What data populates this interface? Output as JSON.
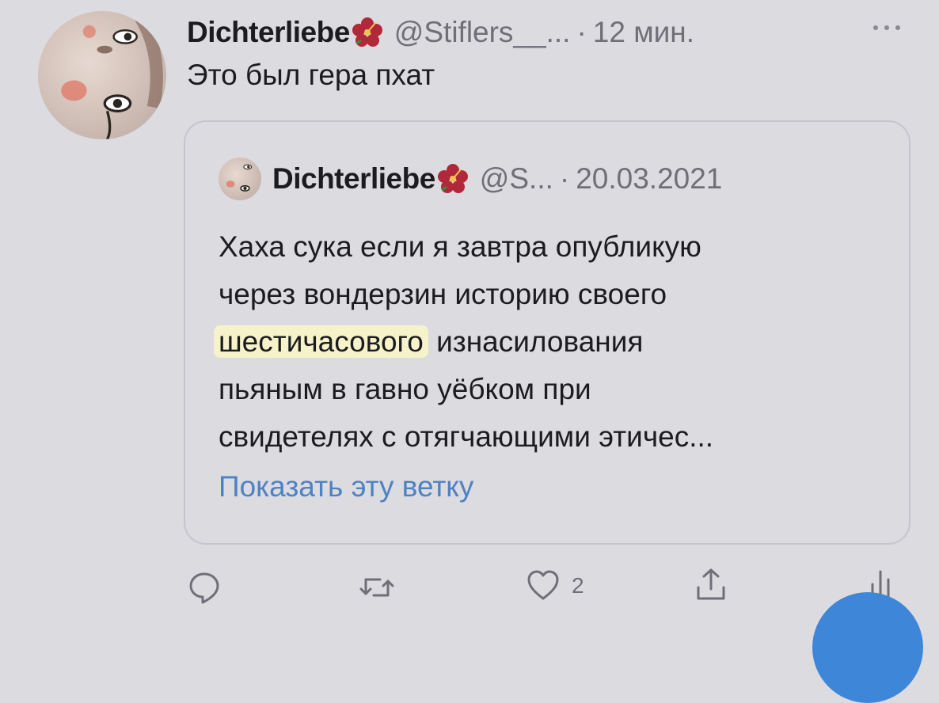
{
  "tweet": {
    "author": {
      "display_name": "Dichterliebe",
      "name_emoji": "hibiscus-flower-icon",
      "handle": "@Stiflers__...",
      "separator": "·",
      "time": "12 мин."
    },
    "text": "Это был гера пхат",
    "more_icon": "more-dots-icon"
  },
  "quoted_tweet": {
    "author": {
      "display_name": "Dichterliebe",
      "name_emoji": "hibiscus-flower-icon",
      "handle": "@S...",
      "separator": "·",
      "date": "20.03.2021"
    },
    "lines": {
      "line1": "Хаха сука если я завтра опубликую",
      "line2": "через вондерзин историю своего",
      "line3_highlighted": "шестичасового",
      "line3_rest": " изнасилования",
      "line4": "пьяным в гавно уёбком при",
      "line5": "свидетелях с отягчающими этичес..."
    },
    "show_thread": "Показать эту ветку"
  },
  "actions": {
    "reply_icon": "reply-bubble-icon",
    "retweet_icon": "retweet-icon",
    "like_icon": "heart-icon",
    "like_count": "2",
    "share_icon": "share-icon",
    "analytics_icon": "analytics-icon"
  },
  "colors": {
    "background": "#dcdbe0",
    "text": "#1c1c20",
    "muted": "#6f6f78",
    "link": "#4d82c4",
    "highlight": "#f6f2c9",
    "fab": "#3e86d8"
  }
}
